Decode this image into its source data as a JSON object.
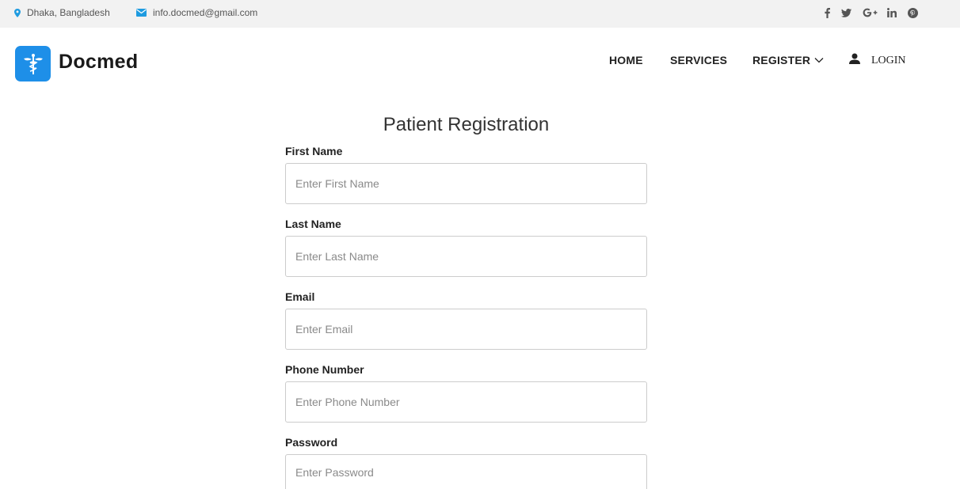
{
  "topbar": {
    "location": "Dhaka, Bangladesh",
    "email": "info.docmed@gmail.com",
    "location_icon": "map-marker-icon",
    "email_icon": "envelope-icon",
    "social": [
      "facebook-icon",
      "twitter-icon",
      "google-plus-icon",
      "linkedin-icon",
      "pinterest-icon"
    ],
    "icon_color": "#1e9be0"
  },
  "header": {
    "brand": "Docmed",
    "brand_color": "#1e8fe8",
    "nav": {
      "home": "HOME",
      "services": "SERVICES",
      "register": "REGISTER",
      "login": "LOGIN"
    }
  },
  "form": {
    "title": "Patient Registration",
    "fields": [
      {
        "label": "First Name",
        "placeholder": "Enter First Name",
        "value": ""
      },
      {
        "label": "Last Name",
        "placeholder": "Enter Last Name",
        "value": ""
      },
      {
        "label": "Email",
        "placeholder": "Enter Email",
        "value": ""
      },
      {
        "label": "Phone Number",
        "placeholder": "Enter Phone Number",
        "value": ""
      },
      {
        "label": "Password",
        "placeholder": "Enter Password",
        "value": ""
      }
    ]
  }
}
